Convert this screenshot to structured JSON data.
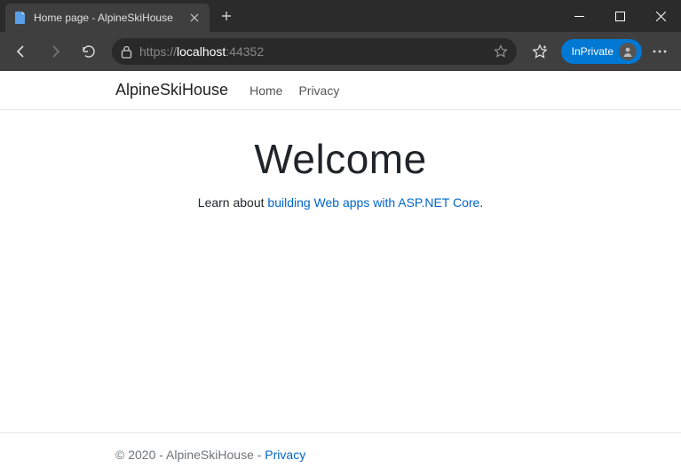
{
  "browser": {
    "tab_title": "Home page - AlpineSkiHouse",
    "url_scheme": "https://",
    "url_host": "localhost",
    "url_port": ":44352",
    "inprivate_label": "InPrivate"
  },
  "nav": {
    "brand": "AlpineSkiHouse",
    "links": [
      {
        "label": "Home"
      },
      {
        "label": "Privacy"
      }
    ]
  },
  "hero": {
    "heading": "Welcome",
    "lead_prefix": "Learn about ",
    "lead_link": "building Web apps with ASP.NET Core",
    "lead_suffix": "."
  },
  "footer": {
    "text": "© 2020 - AlpineSkiHouse - ",
    "link": "Privacy"
  }
}
